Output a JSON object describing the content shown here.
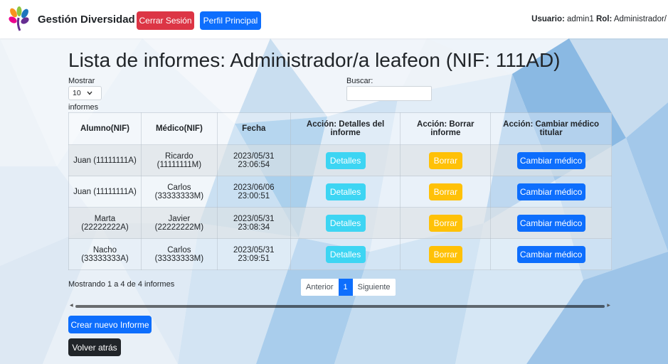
{
  "navbar": {
    "brand": "Gestión Diversidad",
    "logout_label": "Cerrar Sesión",
    "profile_label": "Perfil Principal",
    "user_label": "Usuario:",
    "user_value": "admin1",
    "role_label": "Rol:",
    "role_value": "Administrador/"
  },
  "page": {
    "title": "Lista de informes: Administrador/a leafeon (NIF: 111AD)",
    "show_label": "Mostrar",
    "show_value": "10",
    "entries_label": "informes",
    "search_label": "Buscar:",
    "search_value": "",
    "info_text": "Mostrando 1 a 4 de 4 informes",
    "pagination": {
      "prev": "Anterior",
      "current": "1",
      "next": "Siguiente"
    },
    "new_label": "Crear nuevo Informe",
    "back_label": "Volver atrás"
  },
  "table": {
    "headers": [
      "Alumno(NIF)",
      "Médico(NIF)",
      "Fecha",
      "Acción: Detalles del informe",
      "Acción: Borrar informe",
      "Acción: Cambiar médico titular"
    ],
    "rows": [
      {
        "alumno": "Juan (11111111A)",
        "medico": "Ricardo (11111111M)",
        "fecha": "2023/05/31 23:06:54",
        "details": "Detalles",
        "delete": "Borrar",
        "change": "Cambiar médico"
      },
      {
        "alumno": "Juan (11111111A)",
        "medico": "Carlos (33333333M)",
        "fecha": "2023/06/06 23:00:51",
        "details": "Detalles",
        "delete": "Borrar",
        "change": "Cambiar médico"
      },
      {
        "alumno": "Marta (22222222A)",
        "medico": "Javier (22222222M)",
        "fecha": "2023/05/31 23:08:34",
        "details": "Detalles",
        "delete": "Borrar",
        "change": "Cambiar médico"
      },
      {
        "alumno": "Nacho (33333333A)",
        "medico": "Carlos (33333333M)",
        "fecha": "2023/05/31 23:09:51",
        "details": "Detalles",
        "delete": "Borrar",
        "change": "Cambiar médico"
      }
    ]
  },
  "colors": {
    "danger": "#dc3545",
    "primary": "#0d6efd",
    "info": "#3dd5f3",
    "warning": "#ffc107",
    "dark": "#212529"
  },
  "icons": {
    "logo": "flower-logo-icon",
    "select_arrow": "chevron-down-icon"
  }
}
